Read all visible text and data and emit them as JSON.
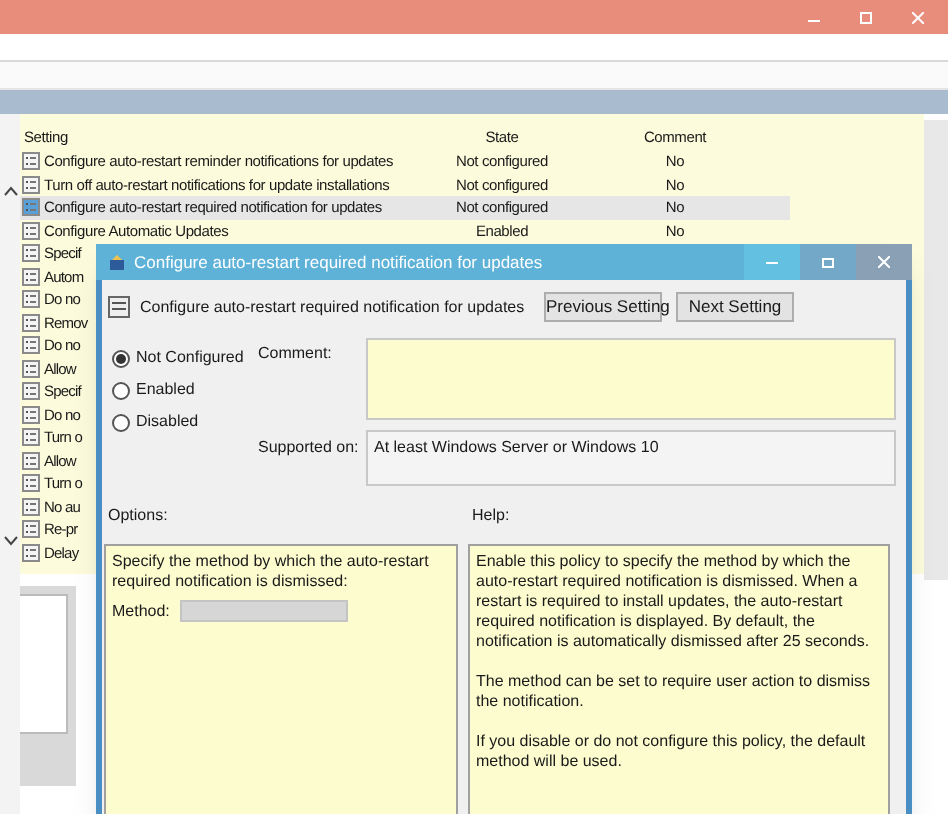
{
  "settings_table": {
    "columns": [
      "Setting",
      "State",
      "Comment"
    ],
    "rows": [
      {
        "setting": "Configure auto-restart reminder notifications for updates",
        "state": "Not configured",
        "comment": "No",
        "selected": false
      },
      {
        "setting": "Turn off auto-restart notifications for update installations",
        "state": "Not configured",
        "comment": "No",
        "selected": false
      },
      {
        "setting": "Configure auto-restart required notification for updates",
        "state": "Not configured",
        "comment": "No",
        "selected": true
      },
      {
        "setting": "Configure Automatic Updates",
        "state": "Enabled",
        "comment": "No",
        "selected": false
      }
    ],
    "partial_rows": [
      "Specif",
      "Autom",
      "Do no",
      "Remov",
      "Do no",
      "Allow",
      "Specif",
      "Do no",
      "Turn o",
      "Allow",
      "Turn o",
      "No au",
      "Re-pr",
      "Delay"
    ]
  },
  "dialog": {
    "title": "Configure auto-restart required notification for updates",
    "heading": "Configure auto-restart required notification for updates",
    "buttons": [
      "Previous Setting",
      "Next Setting"
    ],
    "radios": [
      {
        "label": "Not Configured",
        "selected": true
      },
      {
        "label": "Enabled",
        "selected": false
      },
      {
        "label": "Disabled",
        "selected": false
      }
    ],
    "comment": {
      "label": "Comment:"
    },
    "supported_on": {
      "label": "Supported on:",
      "value": "At least Windows Server or Windows 10"
    },
    "options": {
      "label": "Options:",
      "text": "Specify the method by which the auto-restart required notification is dismissed:",
      "method_label": "Method:"
    },
    "help": {
      "label": "Help:",
      "paragraphs": [
        "Enable this policy to specify the method by which the auto-restart required notification is dismissed. When a restart is required to install updates, the auto-restart required notification is displayed. By default, the notification is automatically dismissed after 25 seconds.",
        "The method can be set to require user action to dismiss the notification.",
        "If you disable or do not configure this policy, the default method will be used."
      ]
    }
  }
}
